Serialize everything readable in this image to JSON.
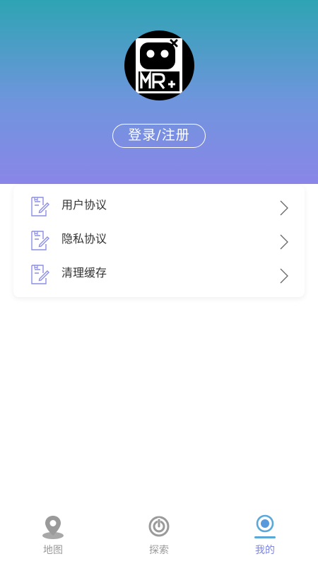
{
  "header": {
    "login_label": "登录/注册"
  },
  "menu": {
    "items": [
      {
        "label": "用户协议",
        "icon": "document-edit-icon"
      },
      {
        "label": "隐私协议",
        "icon": "document-edit-icon"
      },
      {
        "label": "清理缓存",
        "icon": "document-edit-icon"
      }
    ]
  },
  "tabbar": {
    "tabs": [
      {
        "label": "地图",
        "icon": "map-pin-icon",
        "active": false
      },
      {
        "label": "探索",
        "icon": "compass-icon",
        "active": false
      },
      {
        "label": "我的",
        "icon": "profile-icon",
        "active": true
      }
    ]
  },
  "colors": {
    "accent": "#7f86e0",
    "inactive": "#9a9a9a",
    "header_top": "#2ea4b3",
    "header_bottom": "#8a86e8"
  }
}
